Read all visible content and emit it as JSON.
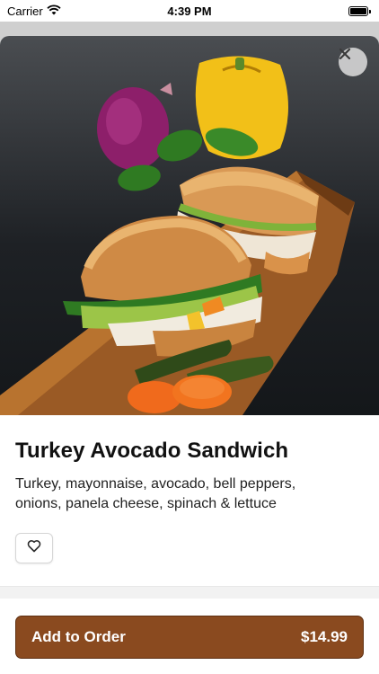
{
  "status_bar": {
    "carrier": "Carrier",
    "time": "4:39 PM",
    "wifi_icon": "wifi-icon",
    "battery_icon": "battery-icon"
  },
  "item": {
    "image_alt": "sandwich-photo",
    "title": "Turkey Avocado Sandwich",
    "description": "Turkey, mayonnaise, avocado, bell peppers, onions, panela cheese, spinach & lettuce"
  },
  "actions": {
    "close_icon": "close-icon",
    "favorite_icon": "heart-icon",
    "add_label": "Add to Order",
    "price": "$14.99"
  },
  "colors": {
    "accent": "#8a4a1f",
    "accent_border": "#5e3012"
  }
}
